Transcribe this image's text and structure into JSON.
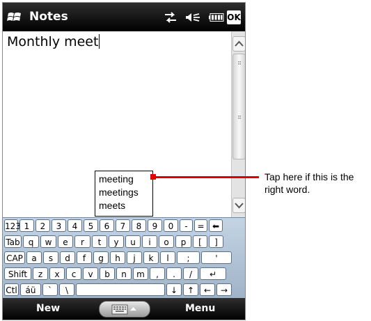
{
  "title_bar": {
    "app_title": "Notes",
    "ok_label": "OK"
  },
  "editor": {
    "text": "Monthly meet"
  },
  "suggestions": [
    "meeting",
    "meetings",
    "meets"
  ],
  "keyboard": {
    "rows": [
      [
        "123",
        "1",
        "2",
        "3",
        "4",
        "5",
        "6",
        "7",
        "8",
        "9",
        "0",
        "-",
        "=",
        "⬅"
      ],
      [
        "Tab",
        "q",
        "w",
        "e",
        "r",
        "t",
        "y",
        "u",
        "i",
        "o",
        "p",
        "[",
        "]"
      ],
      [
        "CAP",
        "a",
        "s",
        "d",
        "f",
        "g",
        "h",
        "j",
        "k",
        "l",
        ";",
        "'"
      ],
      [
        "Shift",
        "z",
        "x",
        "c",
        "v",
        "b",
        "n",
        "m",
        ",",
        ".",
        "/",
        "↵"
      ],
      [
        "Ctl",
        "áü",
        "`",
        "\\",
        " ",
        "↓",
        "↑",
        "←",
        "→"
      ]
    ]
  },
  "menu_bar": {
    "left_softkey": "New",
    "right_softkey": "Menu"
  },
  "annotation": {
    "text": "Tap here if this is the right word."
  },
  "colors": {
    "callout": "#e00000",
    "title_bar": "#000000",
    "keyboard_bg": "#b4c6d9"
  },
  "icons": [
    "windows-start-icon",
    "connectivity-icon",
    "volume-muted-icon",
    "battery-icon",
    "keyboard-icon",
    "caret-up-icon",
    "scroll-up-icon",
    "scroll-down-icon"
  ]
}
